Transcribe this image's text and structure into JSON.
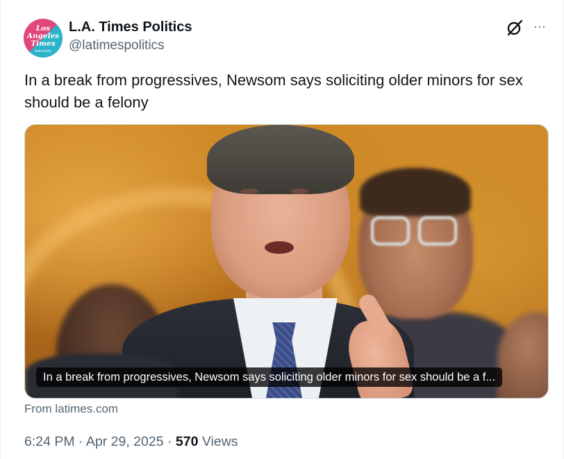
{
  "author": {
    "name": "L.A. Times Politics",
    "handle": "@latimespolitics",
    "avatar_text": [
      "Los",
      "Angeles",
      "Times"
    ],
    "avatar_subtext": "POLITICS",
    "avatar_colors": {
      "primary": "#e0457b",
      "secondary": "#2bb3c9"
    }
  },
  "header_icons": {
    "grok": "grok-icon",
    "more": "more-icon",
    "more_glyph": "···"
  },
  "tweet": {
    "text": "In a break from progressives, Newsom says soliciting older minors for sex should be a felony"
  },
  "card": {
    "caption": "In a break from progressives, Newsom says soliciting older minors for sex should be a f...",
    "source": "From latimes.com"
  },
  "meta": {
    "time": "6:24 PM",
    "separator": " · ",
    "date": "Apr 29, 2025",
    "views_count": "570",
    "views_label": "Views"
  },
  "colors": {
    "text_primary": "#0f1419",
    "text_secondary": "#536471",
    "border": "#cfd9de"
  }
}
